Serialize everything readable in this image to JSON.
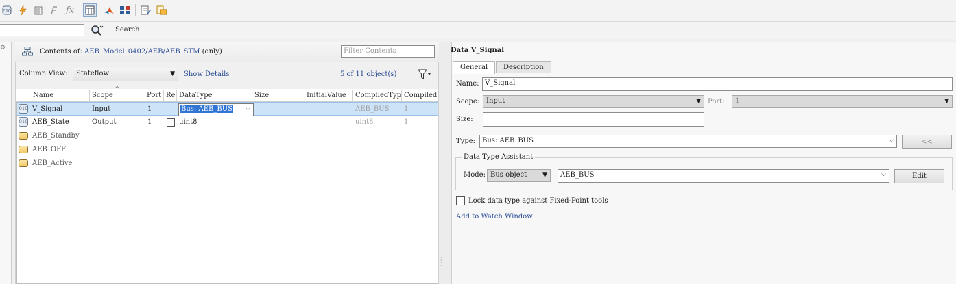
{
  "toolbar": {
    "icons": [
      "data-icon",
      "event-icon",
      "message-icon",
      "simulink-function-icon",
      "fx-icon",
      "column-view-icon",
      "matlab-icon",
      "layout-icon",
      "edit-icon",
      "report-icon"
    ]
  },
  "search": {
    "input_value": "",
    "label": "Search"
  },
  "contents": {
    "prefix": "Contents of:",
    "path": "AEB_Model_0402/AEB/AEB_STM",
    "suffix": "(only)",
    "filter_placeholder": "Filter Contents"
  },
  "column_view": {
    "label": "Column View:",
    "value": "Stateflow",
    "show_details": "Show Details",
    "object_count": "5 of 11 object(s)"
  },
  "table": {
    "headers": [
      "Name",
      "Scope",
      "Port",
      "Re",
      "DataType",
      "Size",
      "InitialValue",
      "CompiledType",
      "CompiledS"
    ],
    "rows": [
      {
        "name": "V_Signal",
        "scope": "Input",
        "port": "1",
        "datatype": "Bus: AEB_BUS",
        "compiled_type": "AEB_BUS",
        "compiled_size": "1"
      },
      {
        "name": "AEB_State",
        "scope": "Output",
        "port": "1",
        "datatype": "uint8",
        "compiled_type": "uint8",
        "compiled_size": "1"
      },
      {
        "name": "AEB_Standby"
      },
      {
        "name": "AEB_OFF"
      },
      {
        "name": "AEB_Active"
      }
    ]
  },
  "details": {
    "title": "Data V_Signal",
    "tabs": [
      "General",
      "Description"
    ],
    "name_label": "Name:",
    "name_value": "V_Signal",
    "scope_label": "Scope:",
    "scope_value": "Input",
    "port_label": "Port:",
    "port_value": "1",
    "size_label": "Size:",
    "size_value": "",
    "type_label": "Type:",
    "type_value": "Bus: AEB_BUS",
    "collapse_button": "<<",
    "assistant_title": "Data Type Assistant",
    "mode_label": "Mode:",
    "mode_value": "Bus object",
    "bus_value": "AEB_BUS",
    "edit_button": "Edit",
    "lock_label": "Lock data type against Fixed-Point tools",
    "watch_link": "Add to Watch Window"
  }
}
